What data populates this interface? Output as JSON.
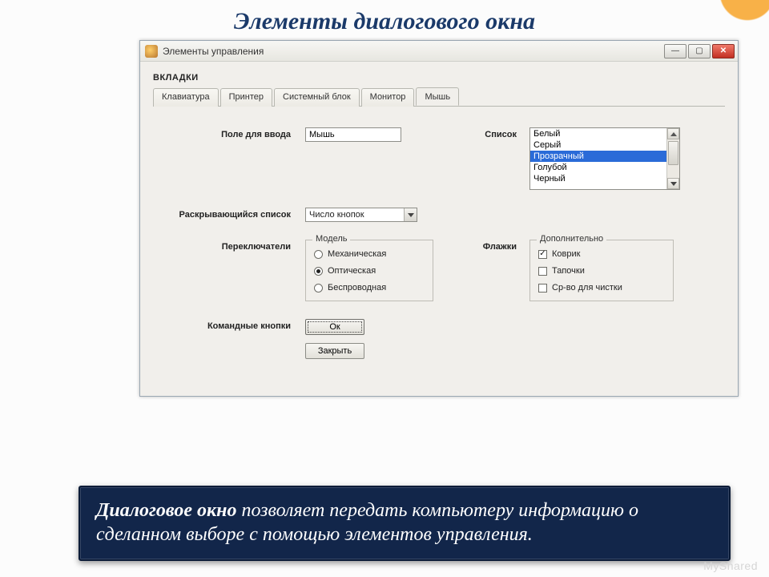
{
  "slide": {
    "title": "Элементы диалогового окна",
    "caption_bold": "Диалоговое окно",
    "caption_rest": " позволяет передать компьютеру информацию о сделанном выборе с помощью элементов управления.",
    "watermark": "MyShared"
  },
  "window": {
    "title": "Элементы управления",
    "section": "ВКЛАДКИ",
    "tabs": [
      "Клавиатура",
      "Принтер",
      "Системный блок",
      "Монитор",
      "Мышь"
    ],
    "active_tab": "Мышь",
    "labels": {
      "input": "Поле для ввода",
      "dropdown": "Раскрывающийся список",
      "radios": "Переключатели",
      "list": "Список",
      "checks": "Флажки",
      "buttons": "Командные кнопки"
    },
    "input_value": "Мышь",
    "dropdown_value": "Число кнопок",
    "radio_group": {
      "legend": "Модель",
      "options": [
        "Механическая",
        "Оптическая",
        "Беспроводная"
      ],
      "selected": "Оптическая"
    },
    "list": {
      "items": [
        "Белый",
        "Серый",
        "Прозрачный",
        "Голубой",
        "Черный"
      ],
      "selected": "Прозрачный"
    },
    "check_group": {
      "legend": "Дополнительно",
      "options": [
        {
          "label": "Коврик",
          "checked": true
        },
        {
          "label": "Тапочки",
          "checked": false
        },
        {
          "label": "Ср-во для чистки",
          "checked": false
        }
      ]
    },
    "buttons": {
      "ok": "Ок",
      "close": "Закрыть"
    }
  }
}
